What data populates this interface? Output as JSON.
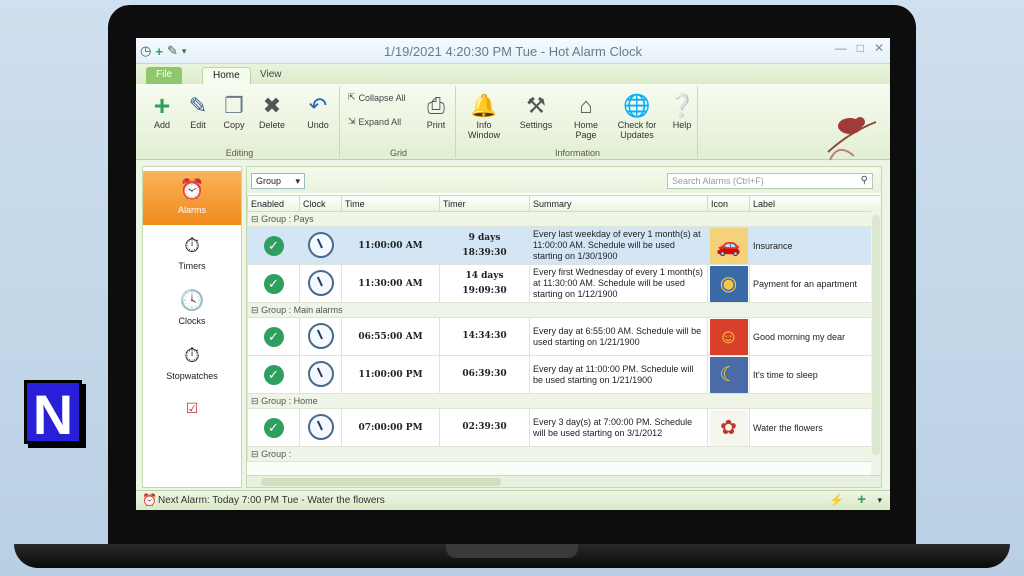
{
  "window": {
    "title": "1/19/2021 4:20:30 PM Tue - Hot Alarm Clock"
  },
  "tabs": [
    {
      "label": "File"
    },
    {
      "label": "Home"
    },
    {
      "label": "View"
    }
  ],
  "ribbon": {
    "editing": {
      "label": "Editing",
      "buttons": [
        {
          "label": "Add",
          "icon": "plus-icon"
        },
        {
          "label": "Edit",
          "icon": "edit-icon"
        },
        {
          "label": "Copy",
          "icon": "copy-icon"
        },
        {
          "label": "Delete",
          "icon": "delete-icon"
        },
        {
          "label": "Undo",
          "icon": "undo-icon"
        }
      ]
    },
    "grid": {
      "label": "Grid",
      "collapse_all": "Collapse All",
      "expand_all": "Expand All",
      "print": "Print"
    },
    "information": {
      "label": "Information",
      "info_window": "Info Window",
      "settings": "Settings",
      "home_page": "Home Page",
      "check_updates": "Check for Updates",
      "help": "Help"
    }
  },
  "sidebar": {
    "items": [
      {
        "label": "Alarms",
        "active": true
      },
      {
        "label": "Timers"
      },
      {
        "label": "Clocks"
      },
      {
        "label": "Stopwatches"
      }
    ]
  },
  "toolbar": {
    "group_dropdown": "Group",
    "search_placeholder": "Search Alarms (Ctrl+F)"
  },
  "columns": [
    "Enabled",
    "Clock",
    "Time",
    "Timer",
    "Summary",
    "Icon",
    "Label"
  ],
  "groups": [
    {
      "name": "Group : Pays",
      "rows": [
        {
          "time": "11:00:00 AM",
          "timer_days": "9 days",
          "timer_time": "18:39:30",
          "summary": "Every last weekday of every 1 month(s) at 11:00:00 AM. Schedule will be used starting on 1/30/1900",
          "icon": "car-money-icon",
          "label": "Insurance",
          "selected": true
        },
        {
          "time": "11:30:00 AM",
          "timer_days": "14 days",
          "timer_time": "19:09:30",
          "summary": "Every first Wednesday of every 1 month(s) at 11:30:00 AM. Schedule will be used starting on 1/12/1900",
          "icon": "coins-icon",
          "label": "Payment for an apartment"
        }
      ]
    },
    {
      "name": "Group : Main alarms",
      "rows": [
        {
          "time": "06:55:00 AM",
          "timer_days": "",
          "timer_time": "14:34:30",
          "summary": "Every day at 6:55:00 AM. Schedule will be used starting on 1/21/1900",
          "icon": "smiley-icon",
          "label": "Good morning my dear"
        },
        {
          "time": "11:00:00 PM",
          "timer_days": "",
          "timer_time": "06:39:30",
          "summary": "Every day at 11:00:00 PM. Schedule will be used starting on 1/21/1900",
          "icon": "moon-icon",
          "label": "It's time to sleep"
        }
      ]
    },
    {
      "name": "Group : Home",
      "rows": [
        {
          "time": "07:00:00 PM",
          "timer_days": "",
          "timer_time": "02:39:30",
          "summary": "Every 3 day(s) at 7:00:00 PM. Schedule will be used starting on 3/1/2012",
          "icon": "flowers-icon",
          "label": "Water the flowers"
        }
      ]
    },
    {
      "name": "Group :",
      "rows": []
    }
  ],
  "status": {
    "next_alarm": "Next Alarm: Today 7:00 PM Tue - Water the flowers"
  },
  "colors": {
    "accent_orange": "#f08a1c",
    "check_green": "#2e9f5e",
    "ribbon_green": "#e2efd2",
    "selected_row": "#d4e6f6"
  }
}
